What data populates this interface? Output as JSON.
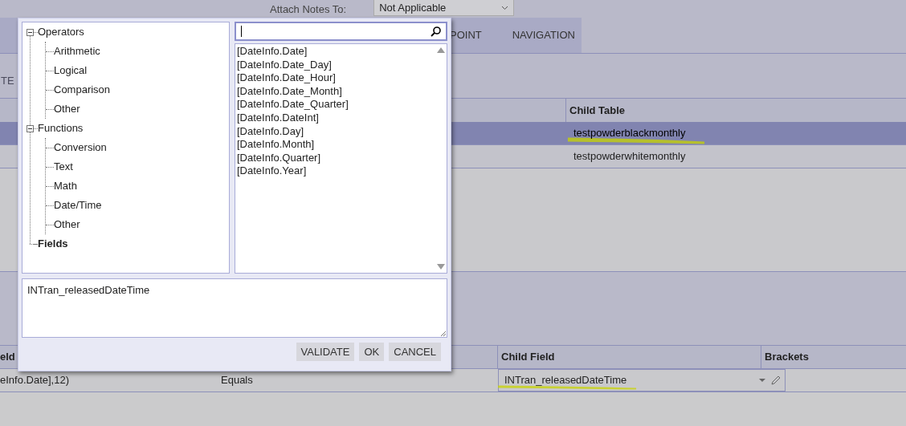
{
  "background": {
    "attach_notes": {
      "label": "Attach Notes To:",
      "value": "Not Applicable"
    },
    "tabs": [
      {
        "label": "POINT",
        "selected": false
      },
      {
        "label": "NAVIGATION",
        "selected": false
      }
    ],
    "toolbar": {
      "label": "TE",
      "disabled": true
    },
    "relations_table": {
      "column": "Child Table",
      "rows": [
        {
          "child_table": "testpowderblackmonthly",
          "selected": true
        },
        {
          "child_table": "testpowderwhitemonthly",
          "selected": false
        }
      ]
    },
    "fields_table": {
      "columns": {
        "parent_field": "eld",
        "child_field": "Child Field",
        "brackets": "Brackets"
      },
      "rows": [
        {
          "parent_field": "eInfo.Date],12)",
          "condition": "Equals",
          "child_field": "INTran_releasedDateTime"
        }
      ]
    }
  },
  "dialog": {
    "tree": [
      {
        "label": "Operators",
        "expanded": true,
        "selected": false,
        "children": [
          {
            "label": "Arithmetic",
            "selected": false
          },
          {
            "label": "Logical",
            "selected": false
          },
          {
            "label": "Comparison",
            "selected": false
          },
          {
            "label": "Other",
            "selected": false
          }
        ]
      },
      {
        "label": "Functions",
        "expanded": true,
        "selected": false,
        "children": [
          {
            "label": "Conversion",
            "selected": false
          },
          {
            "label": "Text",
            "selected": false
          },
          {
            "label": "Math",
            "selected": false
          },
          {
            "label": "Date/Time",
            "selected": false
          },
          {
            "label": "Other",
            "selected": false
          }
        ]
      },
      {
        "label": "Fields",
        "selected": true
      }
    ],
    "items": [
      "[DateInfo.Date]",
      "[DateInfo.Date_Day]",
      "[DateInfo.Date_Hour]",
      "[DateInfo.Date_Month]",
      "[DateInfo.Date_Quarter]",
      "[DateInfo.DateInt]",
      "[DateInfo.Day]",
      "[DateInfo.Month]",
      "[DateInfo.Quarter]",
      "[DateInfo.Year]"
    ],
    "expression": "INTran_releasedDateTime",
    "buttons": [
      "VALIDATE",
      "OK",
      "CANCEL"
    ]
  }
}
